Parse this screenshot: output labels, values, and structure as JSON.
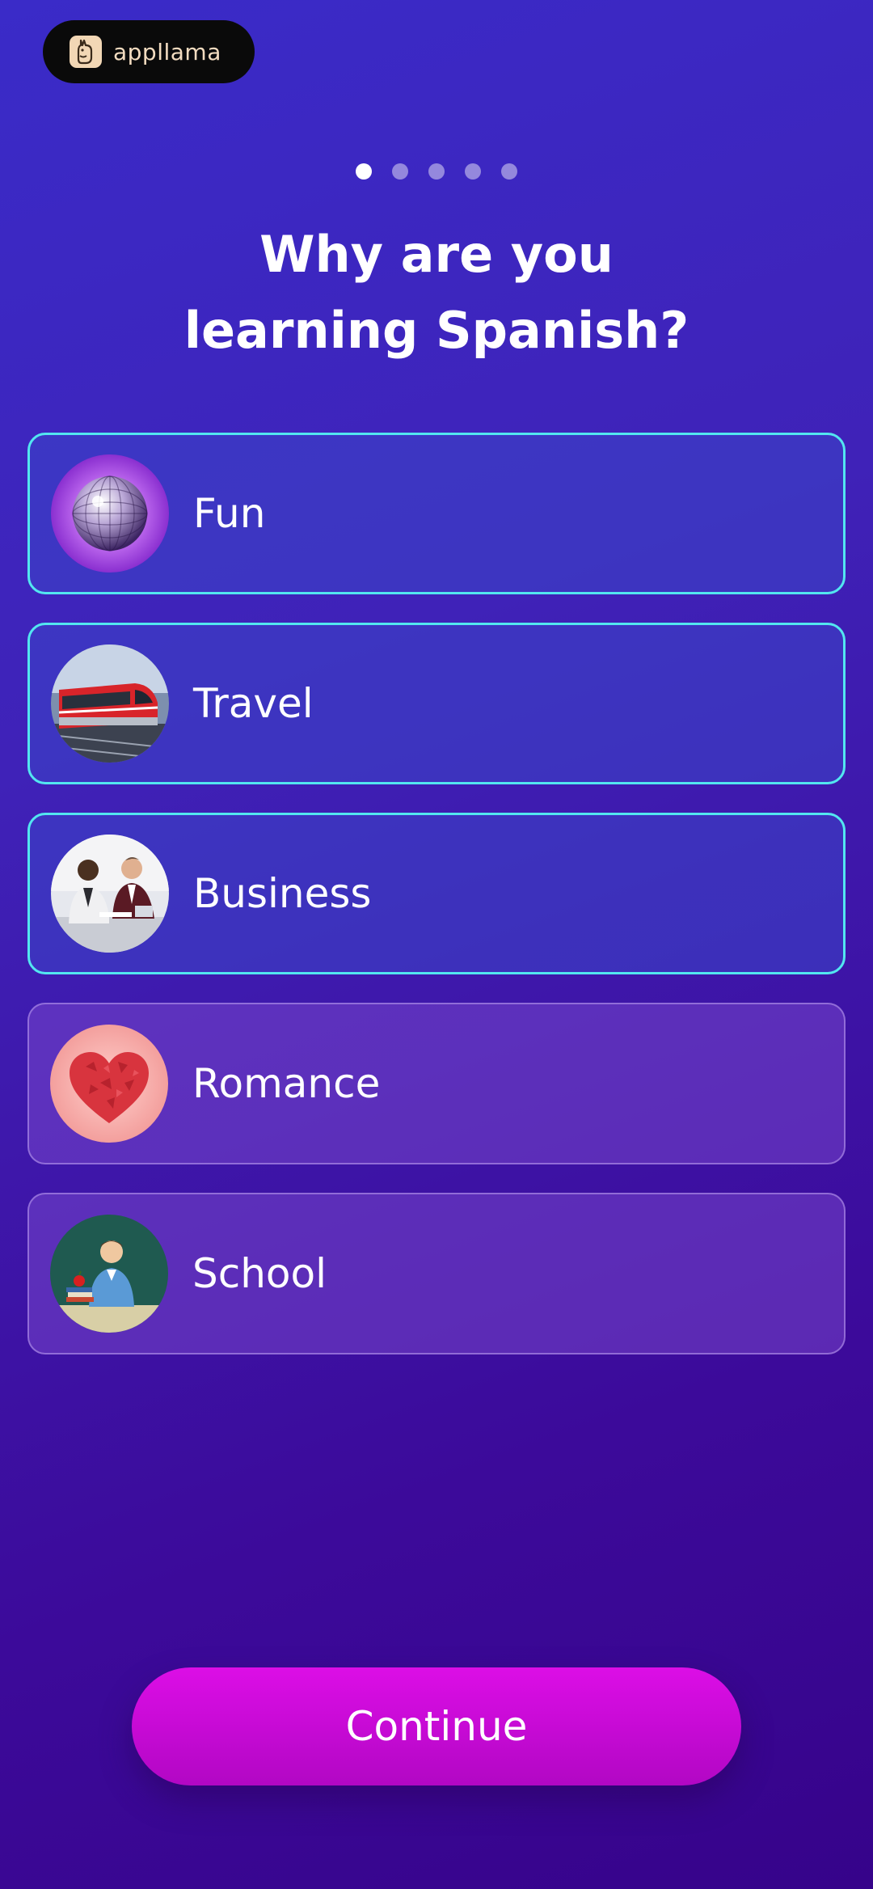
{
  "brand": {
    "name": "appllama",
    "icon": "llama-icon"
  },
  "progress": {
    "total_steps": 5,
    "current_step": 1
  },
  "heading": {
    "line1": "Why are you",
    "line2": "learning Spanish?"
  },
  "options": [
    {
      "label": "Fun",
      "image": "disco-ball-image",
      "selected": true
    },
    {
      "label": "Travel",
      "image": "train-image",
      "selected": true
    },
    {
      "label": "Business",
      "image": "business-meeting-image",
      "selected": true
    },
    {
      "label": "Romance",
      "image": "heart-image",
      "selected": false
    },
    {
      "label": "School",
      "image": "teacher-classroom-image",
      "selected": false
    }
  ],
  "continue_button": {
    "label": "Continue"
  },
  "colors": {
    "selected_border": "#53e6f0",
    "button": "#c80ad6",
    "background": "#3c1ab0"
  }
}
